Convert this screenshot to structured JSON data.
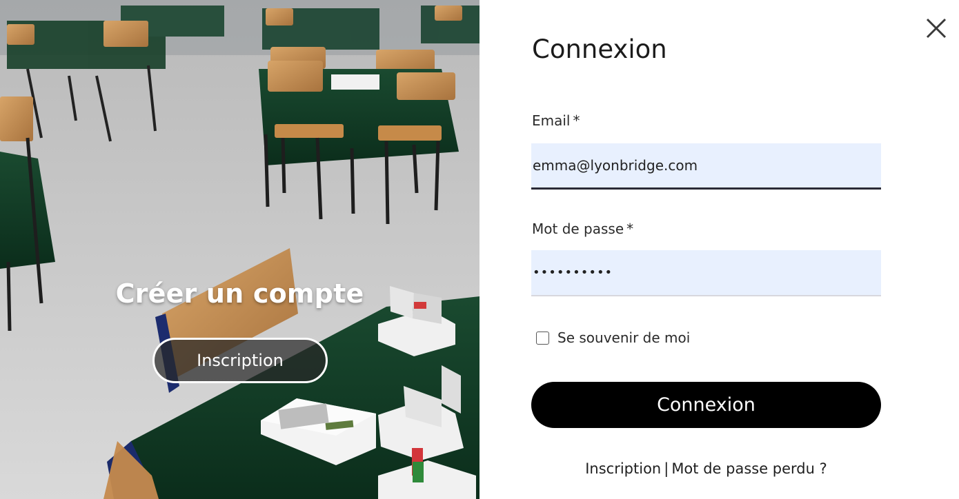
{
  "signup_panel": {
    "title": "Créer un compte",
    "button_label": "Inscription"
  },
  "login": {
    "title": "Connexion",
    "email": {
      "label": "Email",
      "required_mark": "*",
      "value": "emma@lyonbridge.com"
    },
    "password": {
      "label": "Mot de passe",
      "required_mark": "*",
      "value": "••••••••••"
    },
    "remember_me": {
      "label": "Se souvenir de moi",
      "checked": false
    },
    "submit_label": "Connexion",
    "footer": {
      "signup_link": "Inscription",
      "separator": "|",
      "forgot_link": "Mot de passe perdu ?"
    }
  },
  "icons": {
    "close": "close-icon",
    "checkbox": "checkbox-icon"
  },
  "colors": {
    "input_autofill_bg": "#e8f0fe",
    "button_bg": "#000000",
    "table_cloth": "#0f3a24",
    "chair_wood": "#c7925a"
  }
}
